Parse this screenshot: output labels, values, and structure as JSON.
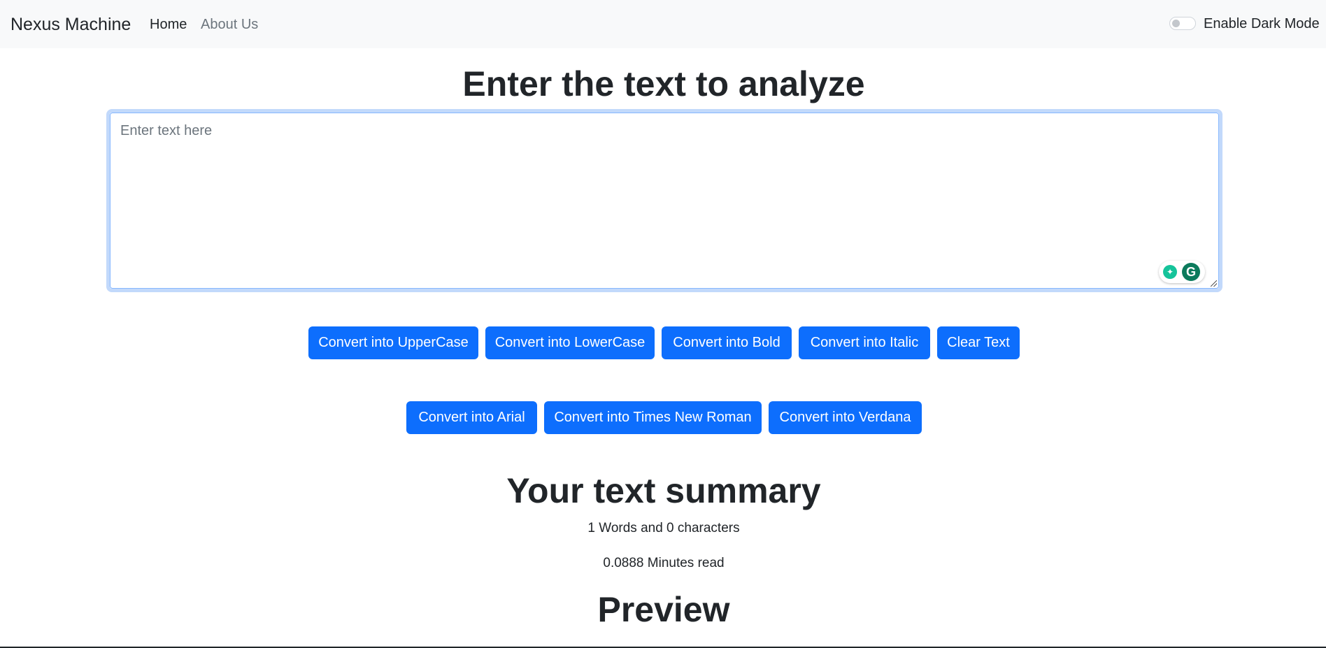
{
  "navbar": {
    "brand": "Nexus Machine",
    "links": [
      {
        "label": "Home",
        "active": true
      },
      {
        "label": "About Us",
        "active": false
      }
    ],
    "dark_mode": {
      "label": "Enable Dark Mode",
      "enabled": false
    }
  },
  "main": {
    "heading": "Enter the text to analyze",
    "textarea": {
      "placeholder": "Enter text here",
      "value": ""
    },
    "buttons_row1": [
      "Convert into UpperCase",
      "Convert into LowerCase",
      "Convert into Bold",
      "Convert into Italic",
      "Clear Text"
    ],
    "buttons_row2": [
      "Convert into Arial",
      "Convert into Times New Roman",
      "Convert into Verdana"
    ]
  },
  "summary": {
    "heading": "Your text summary",
    "counts": "1 Words and 0 characters",
    "read_time": "0.0888 Minutes read"
  },
  "preview": {
    "heading": "Preview"
  },
  "colors": {
    "primary": "#0d6efd",
    "navbar_bg": "#f8f9fa",
    "text": "#212529",
    "muted": "#6c757d"
  }
}
